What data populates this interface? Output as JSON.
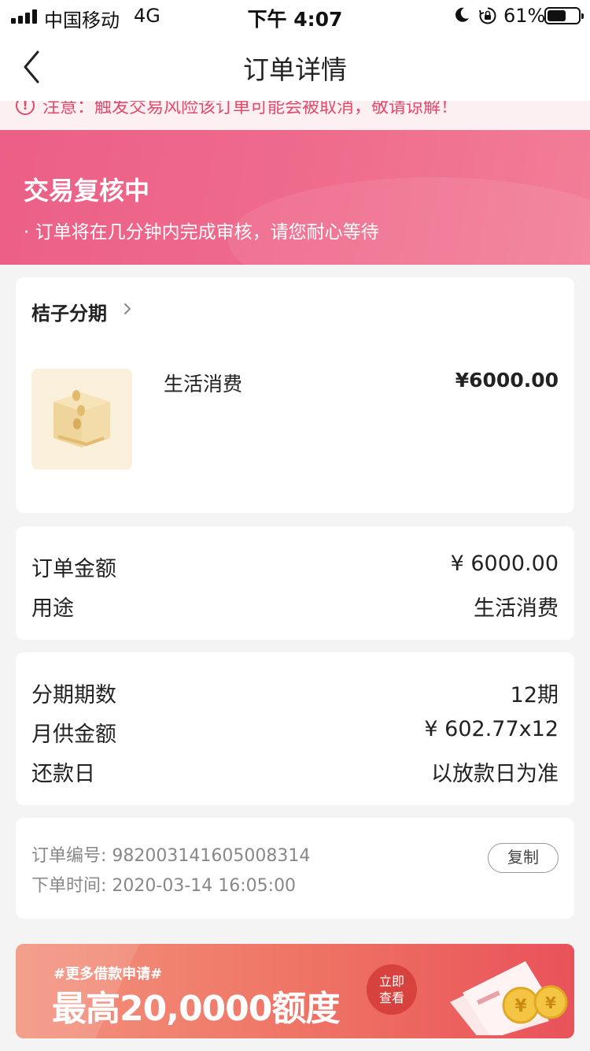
{
  "status_bar": {
    "carrier": "中国移动",
    "network": "4G",
    "time": "下午 4:07",
    "battery_percent": "61%",
    "battery_level": 0.61
  },
  "nav": {
    "title": "订单详情"
  },
  "notice": {
    "text": "注意：触发交易风险该订单可能会被取消，敬请谅解！"
  },
  "status": {
    "title": "交易复核中",
    "description": "· 订单将在几分钟内完成审核，请您耐心等待"
  },
  "merchant": {
    "name": "桔子分期",
    "product_name": "生活消费",
    "product_price": "¥6000.00"
  },
  "amount": {
    "rows": [
      {
        "label": "订单金额",
        "value": "¥ 6000.00"
      },
      {
        "label": "用途",
        "value": "生活消费"
      }
    ]
  },
  "plan": {
    "rows": [
      {
        "label": "分期期数",
        "value": "12期"
      },
      {
        "label": "月供金额",
        "value": "¥ 602.77x12"
      },
      {
        "label": "还款日",
        "value": "以放款日为准"
      }
    ]
  },
  "order": {
    "number": "订单编号: 982003141605008314",
    "time": "下单时间: 2020-03-14 16:05:00",
    "copy_label": "复制"
  },
  "promo": {
    "tag": "#更多借款申请#",
    "headline": "最高20,0000额度",
    "cta": "立即查看"
  },
  "colors": {
    "accent": "#ec5f86",
    "notice_text": "#e24b6b",
    "promo": "#ef7565"
  }
}
